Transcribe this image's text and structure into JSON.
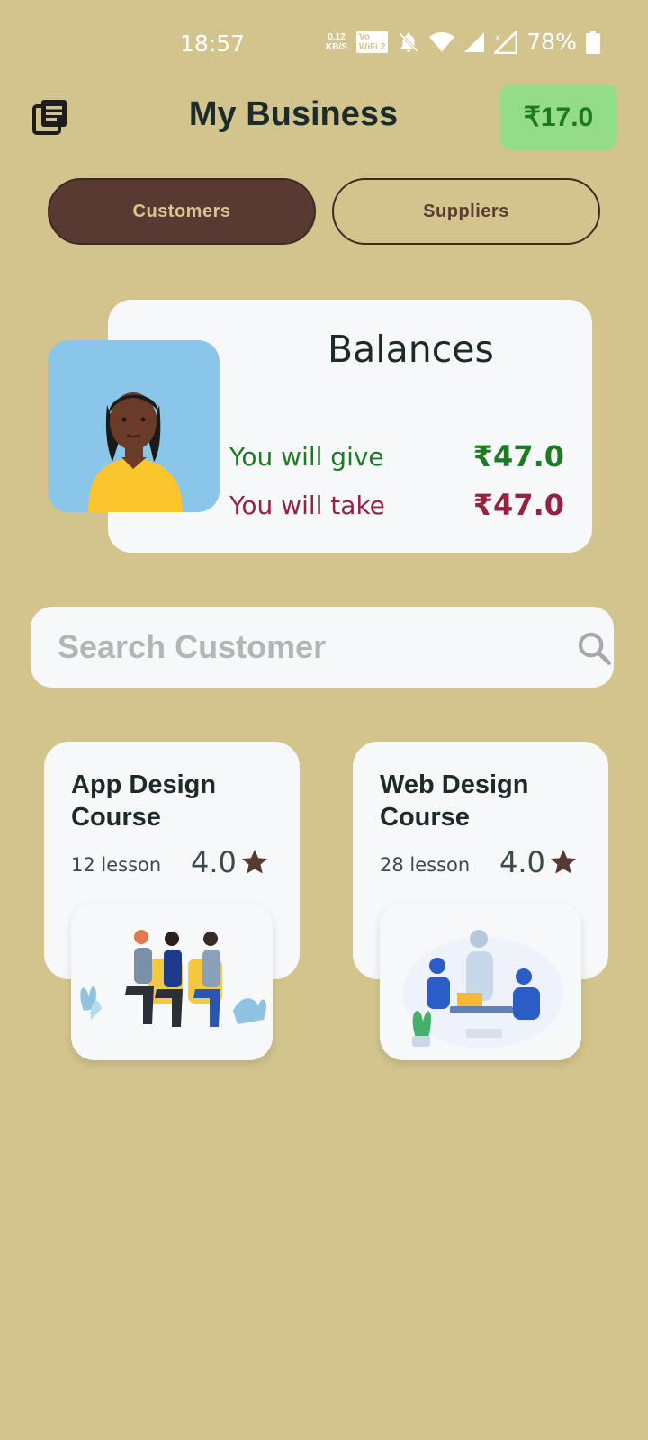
{
  "status_bar": {
    "time": "18:57",
    "net_speed_value": "0.12",
    "net_speed_unit": "KB/S",
    "vowifi_label_top": "Vo",
    "vowifi_label_bottom": "WiFi 2",
    "battery": "78%"
  },
  "header": {
    "title": "My Business",
    "balance": "₹17.0",
    "ledger_icon": "ledger-book-icon"
  },
  "tabs": [
    {
      "label": "Customers",
      "active": true
    },
    {
      "label": "Suppliers",
      "active": false
    }
  ],
  "balances": {
    "title": "Balances",
    "give_label": "You will give",
    "give_amount": "₹47.0",
    "take_label": "You will take",
    "take_amount": "₹47.0"
  },
  "search": {
    "placeholder": "Search Customer",
    "value": ""
  },
  "courses": [
    {
      "title": "App Design Course",
      "lessons": "12 lesson",
      "rating": "4.0"
    },
    {
      "title": "Web Design Course",
      "lessons": "28 lesson",
      "rating": "4.0"
    }
  ],
  "colors": {
    "background": "#d3c48d",
    "active_tab": "#583a32",
    "balance_pill": "#94dc8a",
    "give_color": "#207a25",
    "take_color": "#942342"
  }
}
